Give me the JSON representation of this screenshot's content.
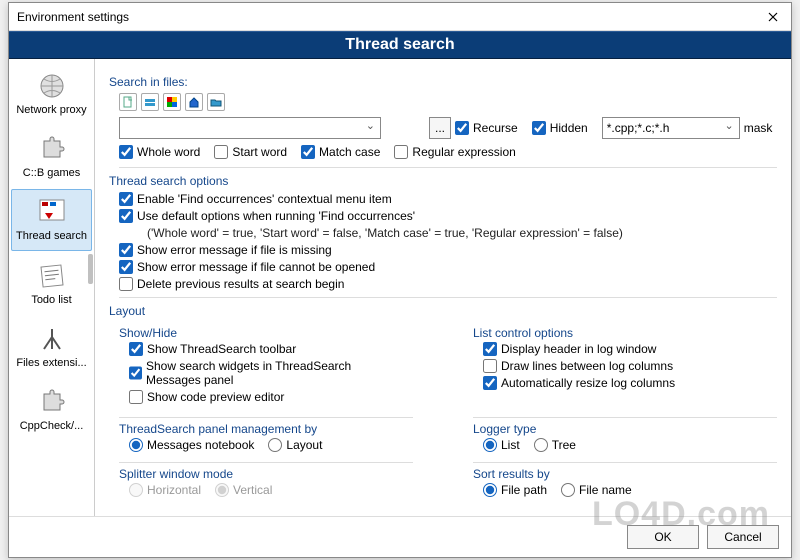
{
  "title": "Environment settings",
  "banner": "Thread search",
  "sidebar": {
    "items": [
      {
        "label": "Network proxy"
      },
      {
        "label": "C::B games"
      },
      {
        "label": "Thread search"
      },
      {
        "label": "Todo list"
      },
      {
        "label": "Files extensi..."
      },
      {
        "label": "CppCheck/..."
      }
    ]
  },
  "search": {
    "label": "Search in files:",
    "value": "",
    "dots": "...",
    "recurse": "Recurse",
    "hidden": "Hidden",
    "mask_value": "*.cpp;*.c;*.h",
    "mask_label": "mask",
    "whole_word": "Whole word",
    "start_word": "Start word",
    "match_case": "Match case",
    "regex": "Regular expression"
  },
  "options": {
    "label": "Thread search options",
    "enable_find": "Enable 'Find occurrences' contextual menu item",
    "use_default": "Use default options when running 'Find occurrences'",
    "default_hint": "('Whole word' = true, 'Start word' = false, 'Match case' = true, 'Regular expression' = false)",
    "err_missing": "Show error message if file is missing",
    "err_open": "Show error message if file cannot be opened",
    "delete_prev": "Delete previous results at search begin"
  },
  "layout": {
    "label": "Layout",
    "showhide": {
      "label": "Show/Hide",
      "toolbar": "Show ThreadSearch toolbar",
      "widgets": "Show search widgets in ThreadSearch Messages panel",
      "preview": "Show code preview editor"
    },
    "listctrl": {
      "label": "List control options",
      "header": "Display header in log window",
      "lines": "Draw lines between log columns",
      "auto_resize": "Automatically resize log columns"
    },
    "panel_mgmt": {
      "label": "ThreadSearch panel management by",
      "messages": "Messages notebook",
      "layout": "Layout"
    },
    "logger": {
      "label": "Logger type",
      "list": "List",
      "tree": "Tree"
    },
    "splitter": {
      "label": "Splitter window mode",
      "horizontal": "Horizontal",
      "vertical": "Vertical"
    },
    "sort": {
      "label": "Sort results by",
      "path": "File path",
      "name": "File name"
    }
  },
  "footer": {
    "ok": "OK",
    "cancel": "Cancel"
  },
  "watermark": "LO4D.com"
}
